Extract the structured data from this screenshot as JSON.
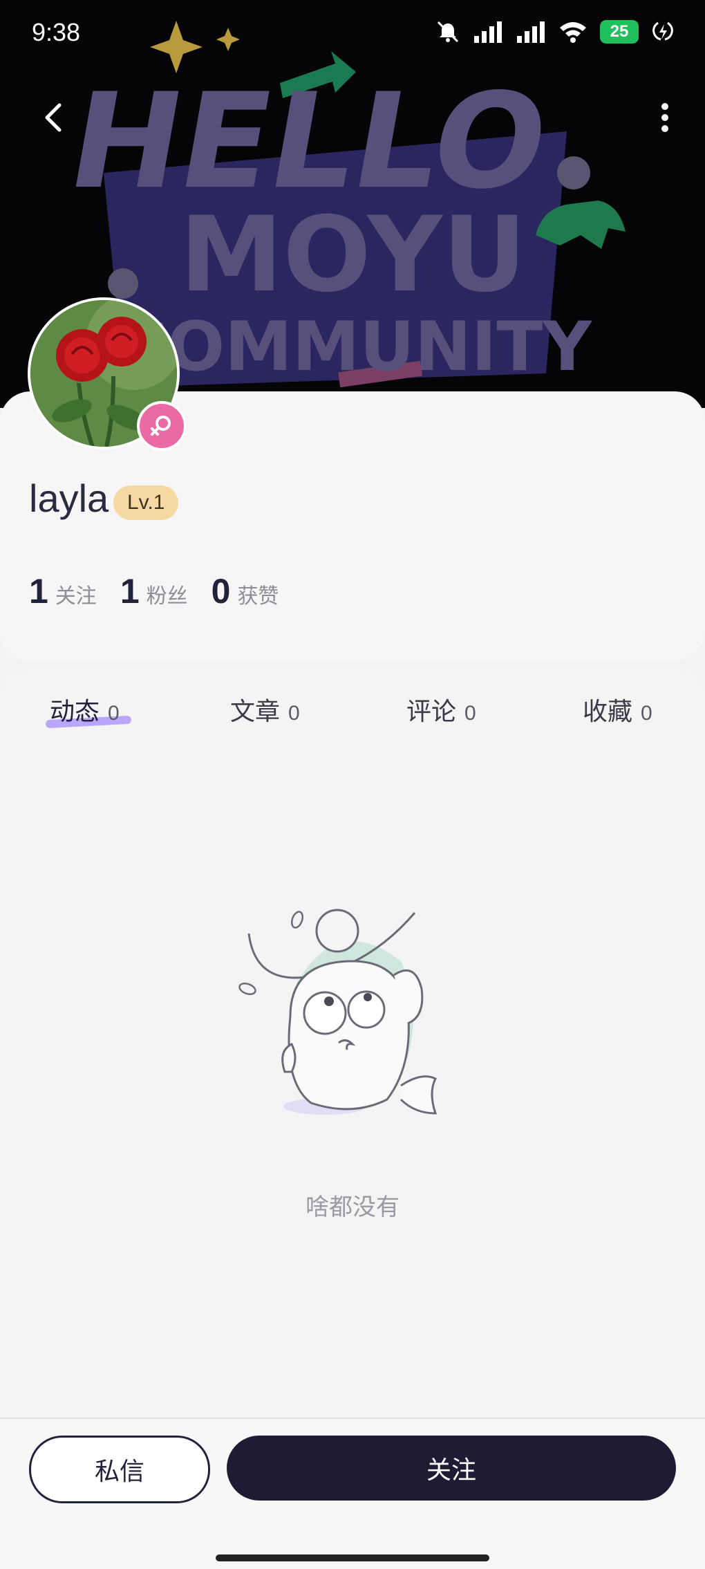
{
  "status_bar": {
    "time": "9:38",
    "battery": "25"
  },
  "banner": {
    "line1": "HELLO",
    "line2": "MOYU",
    "line3": "COMMUNITY"
  },
  "profile": {
    "username": "layla",
    "level": "Lv.1",
    "gender": "female",
    "stats": [
      {
        "num": "1",
        "label": "关注"
      },
      {
        "num": "1",
        "label": "粉丝"
      },
      {
        "num": "0",
        "label": "获赞"
      }
    ]
  },
  "tabs": [
    {
      "label": "动态",
      "count": "0",
      "active": true
    },
    {
      "label": "文章",
      "count": "0"
    },
    {
      "label": "评论",
      "count": "0"
    },
    {
      "label": "收藏",
      "count": "0"
    }
  ],
  "empty": {
    "text": "啥都没有"
  },
  "actions": {
    "message": "私信",
    "follow": "关注"
  },
  "colors": {
    "accent_dark": "#1f1b35",
    "level_badge": "#f6d9a2",
    "tab_underline": "#b9a6ff",
    "gender_badge": "#ea6aa3",
    "banner_text": "#57507a"
  }
}
